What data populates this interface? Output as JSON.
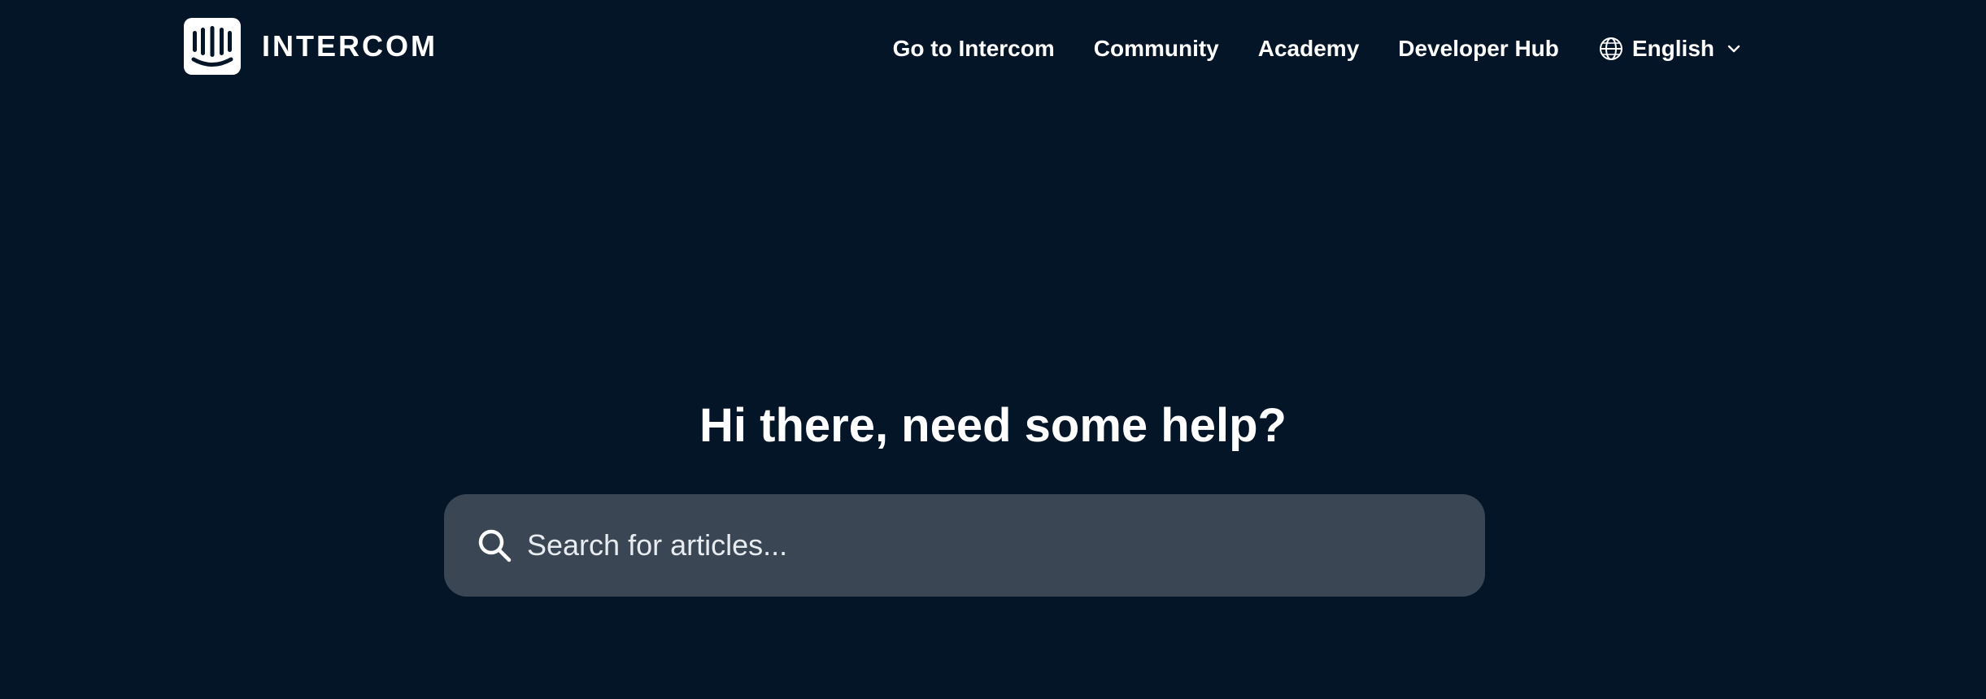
{
  "header": {
    "logo": {
      "text": "INTERCOM",
      "icon": "intercom-logo-icon"
    },
    "nav": {
      "items": [
        {
          "label": "Go to Intercom"
        },
        {
          "label": "Community"
        },
        {
          "label": "Academy"
        },
        {
          "label": "Developer Hub"
        }
      ],
      "language": {
        "label": "English",
        "icon": "globe-icon",
        "dropdown_icon": "chevron-down-icon"
      }
    }
  },
  "hero": {
    "title": "Hi there, need some help?",
    "search": {
      "placeholder": "Search for articles...",
      "icon": "search-icon"
    }
  },
  "colors": {
    "background": "#041528",
    "search_background": "#3a4654",
    "text": "#ffffff"
  }
}
